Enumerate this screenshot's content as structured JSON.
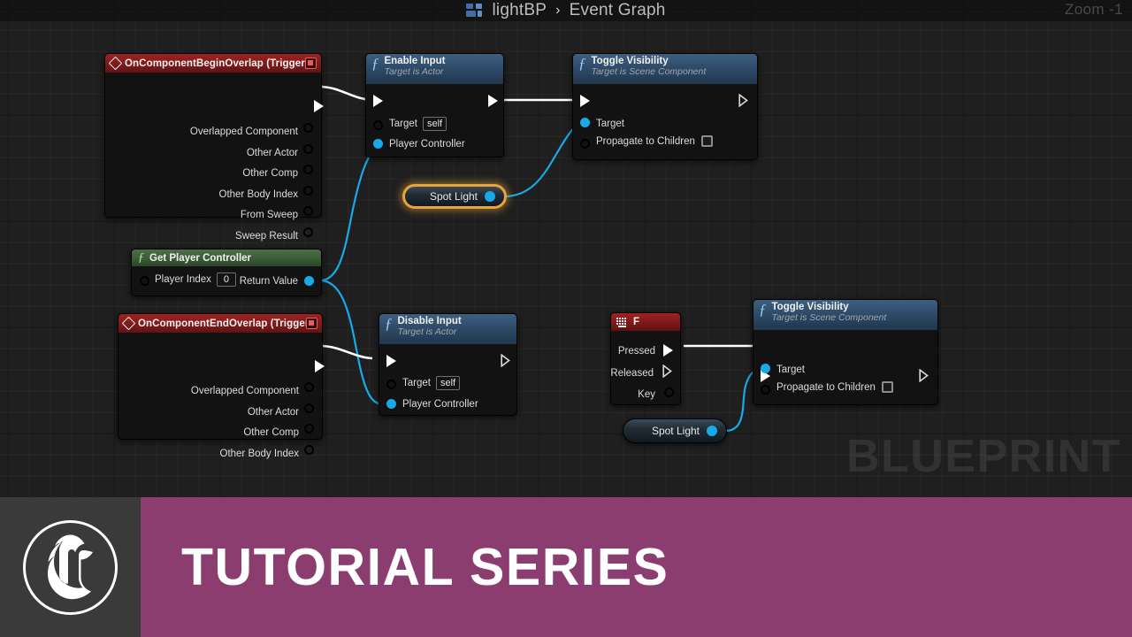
{
  "header": {
    "blueprint_icon": "blueprint-icon",
    "breadcrumb_root": "lightBP",
    "breadcrumb_sep": "›",
    "breadcrumb_current": "Event Graph",
    "zoom_label": "Zoom -1"
  },
  "watermark": "BLUEPRINT",
  "banner": {
    "logo_icon": "unreal-engine-logo",
    "text": "TUTORIAL SERIES",
    "bar_color": "#8a3d6e",
    "logo_box_color": "#3a3a3a"
  },
  "nodes": {
    "begin_overlap": {
      "title": "OnComponentBeginOverlap (Trigger)",
      "pins": [
        "Overlapped Component",
        "Other Actor",
        "Other Comp",
        "Other Body Index",
        "From Sweep",
        "Sweep Result"
      ]
    },
    "enable_input": {
      "title": "Enable Input",
      "subtitle": "Target is Actor",
      "pin_target": "Target",
      "target_value": "self",
      "pin_player_controller": "Player Controller"
    },
    "toggle_visibility_1": {
      "title": "Toggle Visibility",
      "subtitle": "Target is Scene Component",
      "pin_target": "Target",
      "pin_propagate": "Propagate to Children",
      "propagate_checked": false
    },
    "spot_light_1": {
      "label": "Spot Light",
      "selected": true
    },
    "get_player_controller": {
      "title": "Get Player Controller",
      "pin_player_index": "Player Index",
      "player_index_value": "0",
      "pin_return_value": "Return Value"
    },
    "end_overlap": {
      "title": "OnComponentEndOverlap (Trigger)",
      "pins": [
        "Overlapped Component",
        "Other Actor",
        "Other Comp",
        "Other Body Index"
      ]
    },
    "disable_input": {
      "title": "Disable Input",
      "subtitle": "Target is Actor",
      "pin_target": "Target",
      "target_value": "self",
      "pin_player_controller": "Player Controller"
    },
    "f_key": {
      "title": "F",
      "icon": "keyboard-icon",
      "pin_pressed": "Pressed",
      "pin_released": "Released",
      "pin_key": "Key"
    },
    "toggle_visibility_2": {
      "title": "Toggle Visibility",
      "subtitle": "Target is Scene Component",
      "pin_target": "Target",
      "pin_propagate": "Propagate to Children",
      "propagate_checked": false
    },
    "spot_light_2": {
      "label": "Spot Light",
      "selected": false
    }
  },
  "colors": {
    "exec_wire": "#ffffff",
    "object_wire": "#18a9e8",
    "event_header": "#7e1a1a",
    "function_header": "#2e4c69",
    "pure_function_header": "#3c5b38",
    "selection": "#e8a33d",
    "canvas": "#1f1f1f"
  }
}
